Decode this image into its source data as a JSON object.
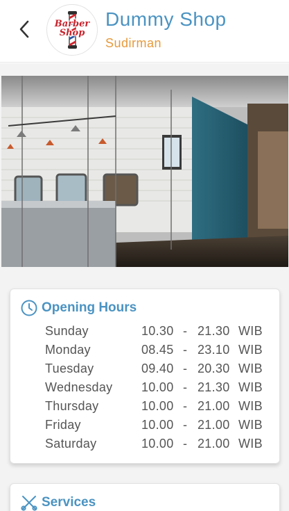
{
  "header": {
    "shop_name": "Dummy Shop",
    "branch": "Sudirman",
    "logo_text_line1": "Barber",
    "logo_text_line2": "Shop"
  },
  "photo": {
    "alt": "shop-interior-photo"
  },
  "opening_hours": {
    "title": "Opening Hours",
    "rows": [
      {
        "day": "Sunday",
        "open": "10.30",
        "sep": "-",
        "close": "21.30",
        "tz": "WIB"
      },
      {
        "day": "Monday",
        "open": "08.45",
        "sep": "-",
        "close": "23.10",
        "tz": "WIB"
      },
      {
        "day": "Tuesday",
        "open": "09.40",
        "sep": "-",
        "close": "20.30",
        "tz": "WIB"
      },
      {
        "day": "Wednesday",
        "open": "10.00",
        "sep": "-",
        "close": "21.30",
        "tz": "WIB"
      },
      {
        "day": "Thursday",
        "open": "10.00",
        "sep": "-",
        "close": "21.00",
        "tz": "WIB"
      },
      {
        "day": "Friday",
        "open": "10.00",
        "sep": "-",
        "close": "21.00",
        "tz": "WIB"
      },
      {
        "day": "Saturday",
        "open": "10.00",
        "sep": "-",
        "close": "21.00",
        "tz": "WIB"
      }
    ]
  },
  "services": {
    "title": "Services"
  },
  "colors": {
    "accent": "#4b93c2",
    "branch": "#e69a3c",
    "background": "#f3f3f3"
  }
}
